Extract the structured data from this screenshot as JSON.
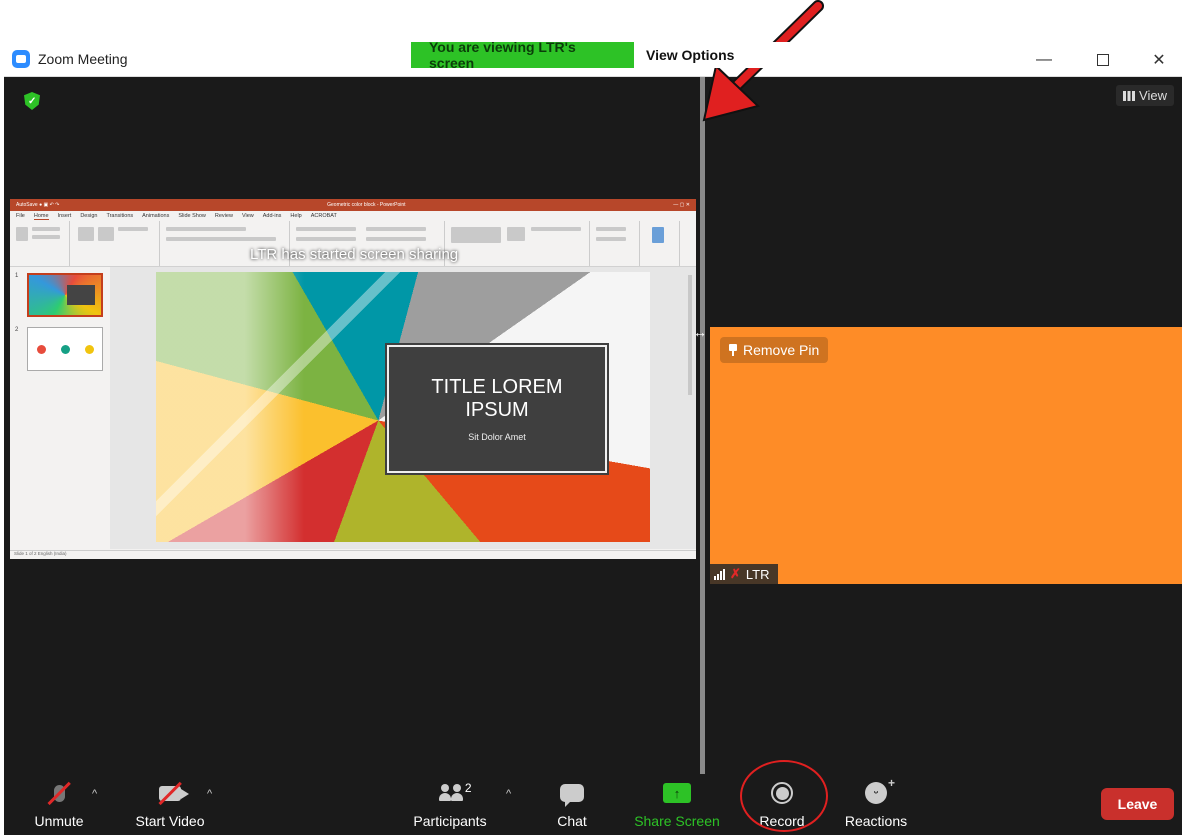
{
  "window": {
    "title": "Zoom Meeting",
    "minimize_glyph": "—",
    "close_glyph": "✕"
  },
  "banner": {
    "viewing_text": "You are viewing LTR's screen",
    "view_options_label": "View Options"
  },
  "top_right": {
    "view_label": "View"
  },
  "shared_screen": {
    "app": "Geometric color block - PowerPoint",
    "ribbon_tabs": [
      "File",
      "Home",
      "Insert",
      "Design",
      "Transitions",
      "Animations",
      "Slide Show",
      "Review",
      "View",
      "Add-ins",
      "Help",
      "ACROBAT"
    ],
    "slide_title": "TITLE LOREM IPSUM",
    "slide_subtitle": "Sit Dolor Amet",
    "slide_numbers": [
      "1",
      "2"
    ],
    "sharing_notice": "LTR has started screen sharing",
    "status_left": "Slide 1 of 2    English (India)"
  },
  "participant_tile": {
    "remove_pin_label": "Remove Pin",
    "name": "LTR",
    "color": "#fe8c27"
  },
  "toolbar": {
    "unmute_label": "Unmute",
    "start_video_label": "Start Video",
    "participants_label": "Participants",
    "participants_count": "2",
    "chat_label": "Chat",
    "share_screen_label": "Share Screen",
    "record_label": "Record",
    "reactions_label": "Reactions",
    "leave_label": "Leave",
    "share_color": "#2dc226",
    "leave_color": "#c9302c"
  },
  "annotations": {
    "arrow_color": "#e02020",
    "circle_color": "#e02020"
  }
}
